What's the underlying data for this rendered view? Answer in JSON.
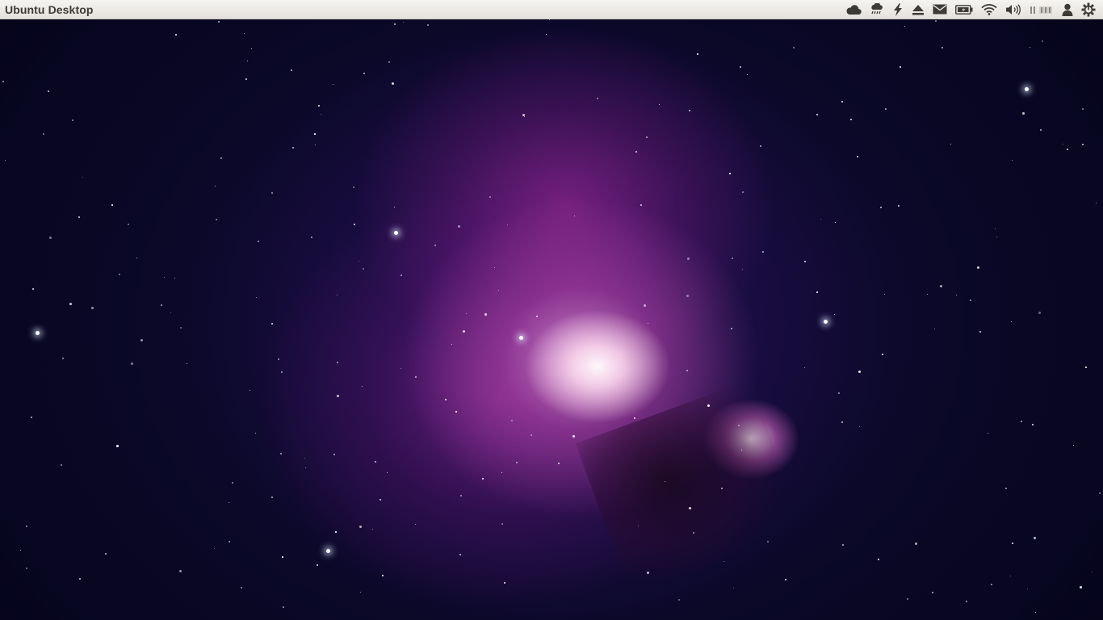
{
  "panel": {
    "title": "Ubuntu Desktop",
    "indicators": [
      {
        "icon": "cloud-icon"
      },
      {
        "icon": "weather-rain-icon"
      },
      {
        "icon": "lightning-icon"
      },
      {
        "icon": "eject-icon"
      },
      {
        "icon": "mail-icon"
      },
      {
        "icon": "battery-icon"
      },
      {
        "icon": "wifi-icon"
      },
      {
        "icon": "volume-icon"
      },
      {
        "icon": "keyboard-indicator-icon"
      },
      {
        "icon": "user-icon"
      },
      {
        "icon": "power-gear-icon"
      }
    ]
  },
  "desktop": {
    "wallpaper": "nebula-wallpaper"
  },
  "colors": {
    "panel_bg": "#eceae6",
    "panel_text": "#3c3b37",
    "icon": "#3c3b37",
    "space": "#06041a",
    "nebula_core": "#fff4fa",
    "nebula_mid": "#c24fb8",
    "nebula_outer": "#3a1870"
  }
}
